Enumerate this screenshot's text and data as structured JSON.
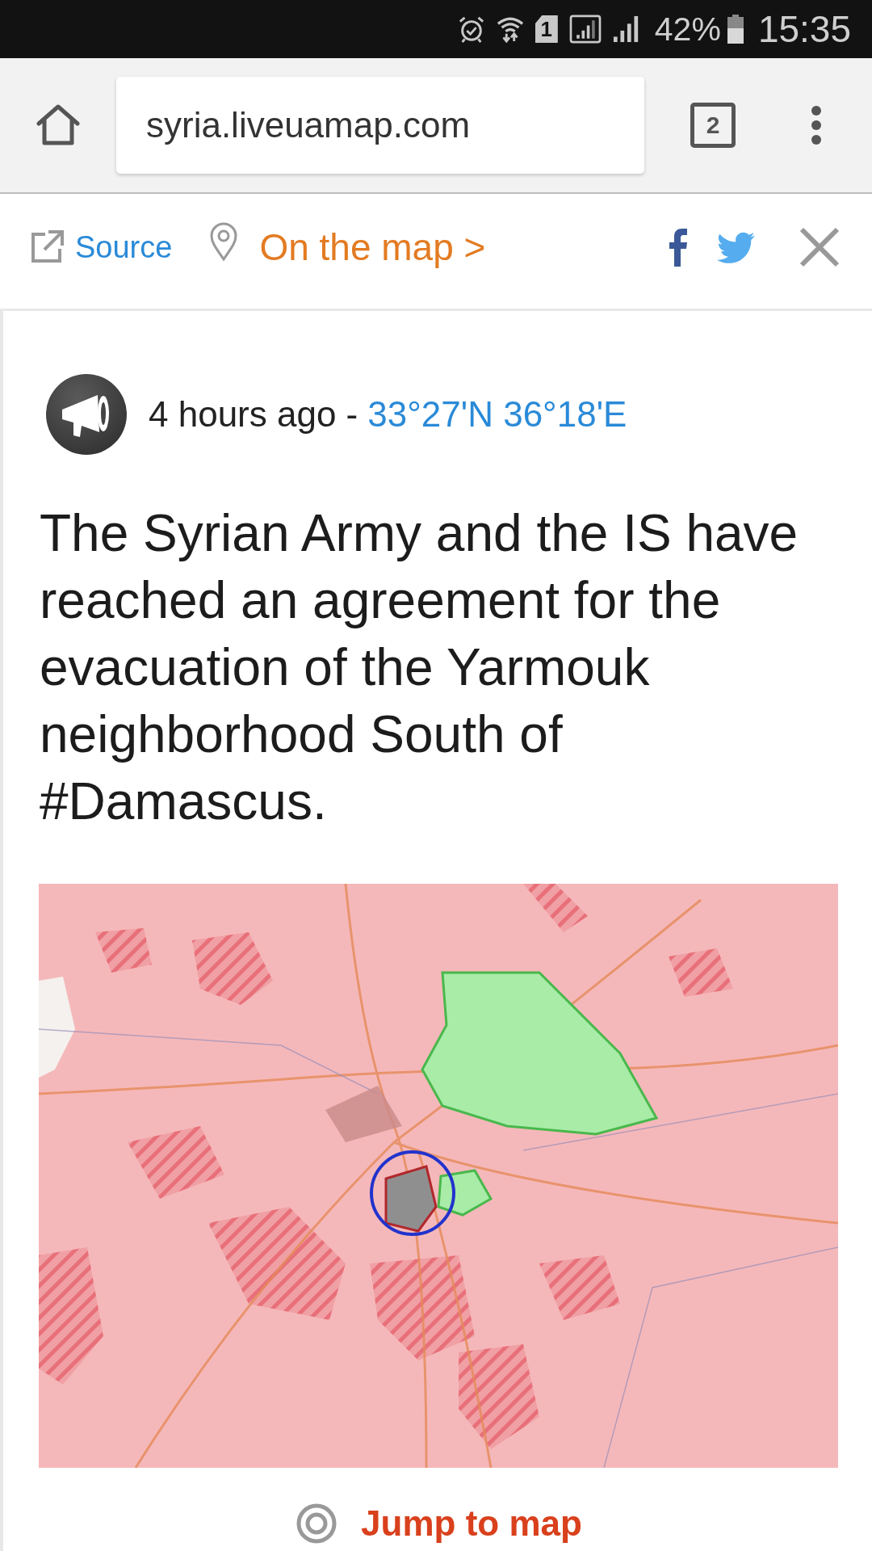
{
  "status_bar": {
    "sim_slot": "1",
    "battery": "42%",
    "time": "15:35"
  },
  "browser": {
    "url": "syria.liveuamap.com",
    "tab_count": "2"
  },
  "action_bar": {
    "source_link": "Source",
    "map_link": "On the map >"
  },
  "post": {
    "time": "4 hours ago -",
    "coordinates": "33°27'N 36°18'E",
    "text": "The Syrian Army and the IS have reached an agreement for the evacuation of the Yarmouk neighborhood South of #Damascus."
  },
  "jump_button": {
    "label": "Jump to map"
  }
}
